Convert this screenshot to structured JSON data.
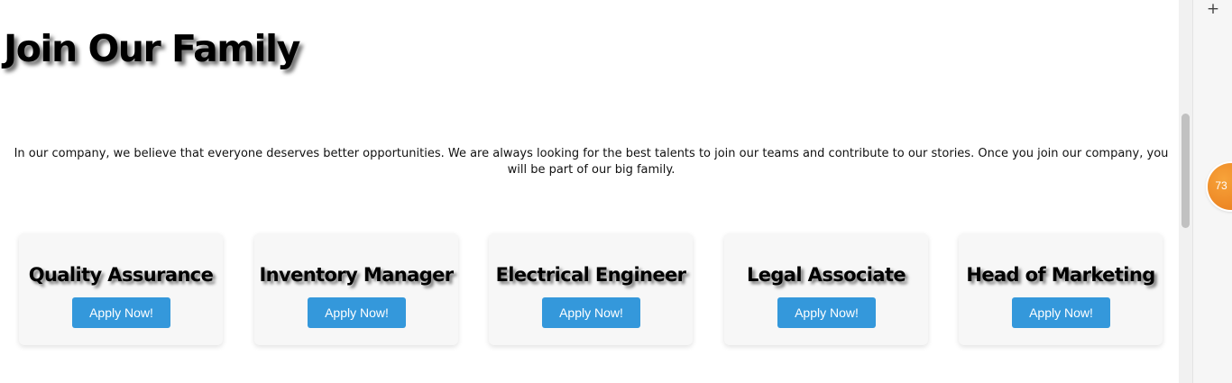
{
  "header": {
    "title": "Join Our Family"
  },
  "intro": {
    "text": "In our company, we believe that everyone deserves better opportunities. We are always looking for the best talents to join our teams and contribute to our stories. Once you join our company, you will be part of our big family."
  },
  "jobs": [
    {
      "title": "Quality Assurance",
      "button_label": "Apply Now!"
    },
    {
      "title": "Inventory Manager",
      "button_label": "Apply Now!"
    },
    {
      "title": "Electrical Engineer",
      "button_label": "Apply Now!"
    },
    {
      "title": "Legal Associate",
      "button_label": "Apply Now!"
    },
    {
      "title": "Head of Marketing",
      "button_label": "Apply Now!"
    }
  ],
  "side_panel": {
    "add_icon": "plus-icon",
    "add_glyph": "+",
    "badge_count": "73"
  },
  "colors": {
    "button": "#3498db",
    "card": "#f7f7f7",
    "badge": "#f0902a"
  }
}
